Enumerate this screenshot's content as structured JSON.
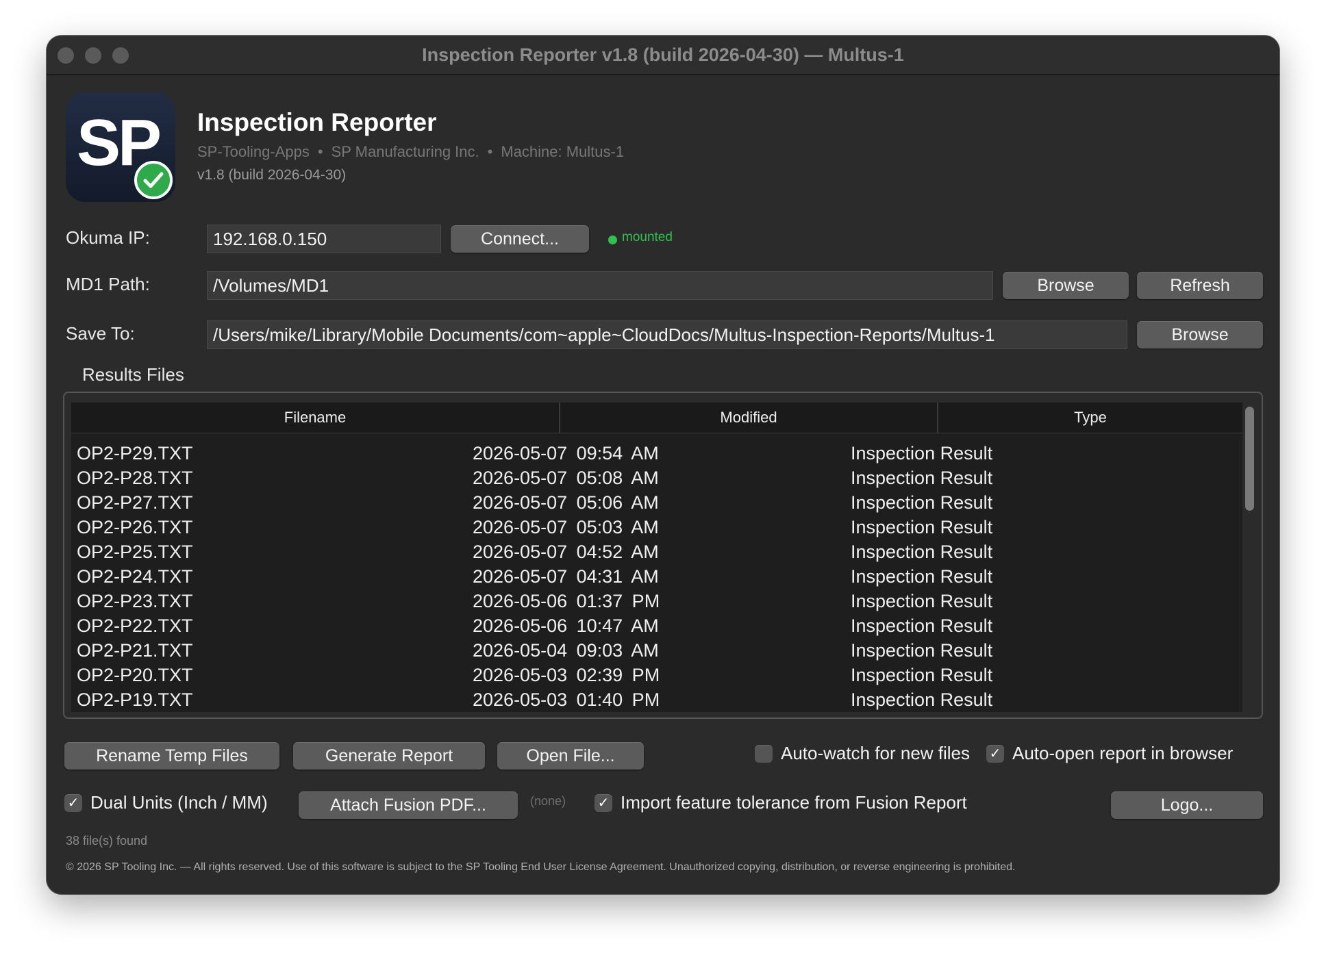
{
  "window": {
    "title": "Inspection Reporter v1.8 (build 2026-04-30) — Multus-1"
  },
  "header": {
    "logo_text": "SP",
    "app_name": "Inspection Reporter",
    "org": "SP-Tooling-Apps",
    "separator": "•",
    "company": "SP Manufacturing Inc.",
    "machine": "Machine: Multus-1",
    "version": "v1.8 (build 2026-04-30)"
  },
  "okuma": {
    "label": "Okuma IP:",
    "value": "192.168.0.150",
    "connect_label": "Connect...",
    "status": "mounted",
    "status_color": "#30c24e"
  },
  "md1": {
    "label": "MD1 Path:",
    "value": "/Volumes/MD1",
    "browse_label": "Browse",
    "refresh_label": "Refresh"
  },
  "save_to": {
    "label": "Save To:",
    "value": "/Users/mike/Library/Mobile Documents/com~apple~CloudDocs/Multus-Inspection-Reports/Multus-1",
    "browse_label": "Browse"
  },
  "results": {
    "title": "Results Files",
    "columns": [
      "Filename",
      "Modified",
      "Type"
    ],
    "rows": [
      {
        "filename": "OP2-P29.TXT",
        "modified": "2026-05-07 09:54 AM",
        "type": "Inspection Result"
      },
      {
        "filename": "OP2-P28.TXT",
        "modified": "2026-05-07 05:08 AM",
        "type": "Inspection Result"
      },
      {
        "filename": "OP2-P27.TXT",
        "modified": "2026-05-07 05:06 AM",
        "type": "Inspection Result"
      },
      {
        "filename": "OP2-P26.TXT",
        "modified": "2026-05-07 05:03 AM",
        "type": "Inspection Result"
      },
      {
        "filename": "OP2-P25.TXT",
        "modified": "2026-05-07 04:52 AM",
        "type": "Inspection Result"
      },
      {
        "filename": "OP2-P24.TXT",
        "modified": "2026-05-07 04:31 AM",
        "type": "Inspection Result"
      },
      {
        "filename": "OP2-P23.TXT",
        "modified": "2026-05-06 01:37 PM",
        "type": "Inspection Result"
      },
      {
        "filename": "OP2-P22.TXT",
        "modified": "2026-05-06 10:47 AM",
        "type": "Inspection Result"
      },
      {
        "filename": "OP2-P21.TXT",
        "modified": "2026-05-04 09:03 AM",
        "type": "Inspection Result"
      },
      {
        "filename": "OP2-P20.TXT",
        "modified": "2026-05-03 02:39 PM",
        "type": "Inspection Result"
      },
      {
        "filename": "OP2-P19.TXT",
        "modified": "2026-05-03 01:40 PM",
        "type": "Inspection Result"
      }
    ]
  },
  "actions": {
    "rename_label": "Rename Temp Files",
    "generate_label": "Generate Report",
    "open_label": "Open File...",
    "auto_watch_label": "Auto-watch for new files",
    "auto_watch_checked": false,
    "auto_open_label": "Auto-open report in browser",
    "auto_open_checked": true
  },
  "options": {
    "dual_units_label": "Dual Units (Inch / MM)",
    "dual_units_checked": true,
    "attach_label": "Attach Fusion PDF...",
    "attach_status": "(none)",
    "import_tol_label": "Import feature tolerance from Fusion Report",
    "import_tol_checked": true,
    "logo_label": "Logo..."
  },
  "footer": {
    "count": "38 file(s) found",
    "copyright": "© 2026 SP Tooling Inc. — All rights reserved. Use of this software is subject to the SP Tooling End User License Agreement. Unauthorized copying, distribution, or reverse engineering is prohibited."
  }
}
